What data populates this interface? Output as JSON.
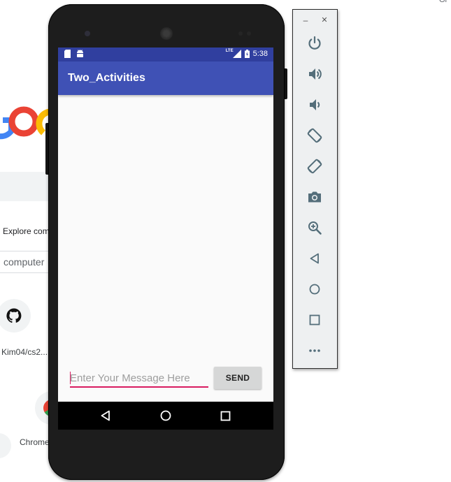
{
  "browser_background": {
    "explore_text": "Explore com",
    "search_query": "computer",
    "shortcut_github_label": "Kim04/cs2...",
    "shortcut_chrome_label": "Chrome",
    "corner_text": "Gr"
  },
  "device": {
    "status_bar": {
      "time": "5:38",
      "network_label": "LTE",
      "left_icons": [
        "sd-card-icon",
        "android-icon"
      ],
      "right_icons": [
        "signal-icon",
        "battery-icon"
      ]
    },
    "app": {
      "title": "Two_Activities",
      "message_input": {
        "value": "",
        "placeholder": "Enter Your Message Here"
      },
      "send_button_label": "SEND",
      "colors": {
        "primary": "#3f51b5",
        "primary_dark": "#303f9f",
        "accent": "#d81b60"
      }
    },
    "nav_bar": [
      "back-icon",
      "home-icon",
      "recents-icon"
    ]
  },
  "emulator_toolbar": {
    "window_controls": [
      "minimize",
      "close"
    ],
    "buttons": [
      "power",
      "volume-up",
      "volume-down",
      "rotate-left",
      "rotate-right",
      "screenshot",
      "zoom",
      "back",
      "home",
      "overview",
      "more"
    ]
  }
}
